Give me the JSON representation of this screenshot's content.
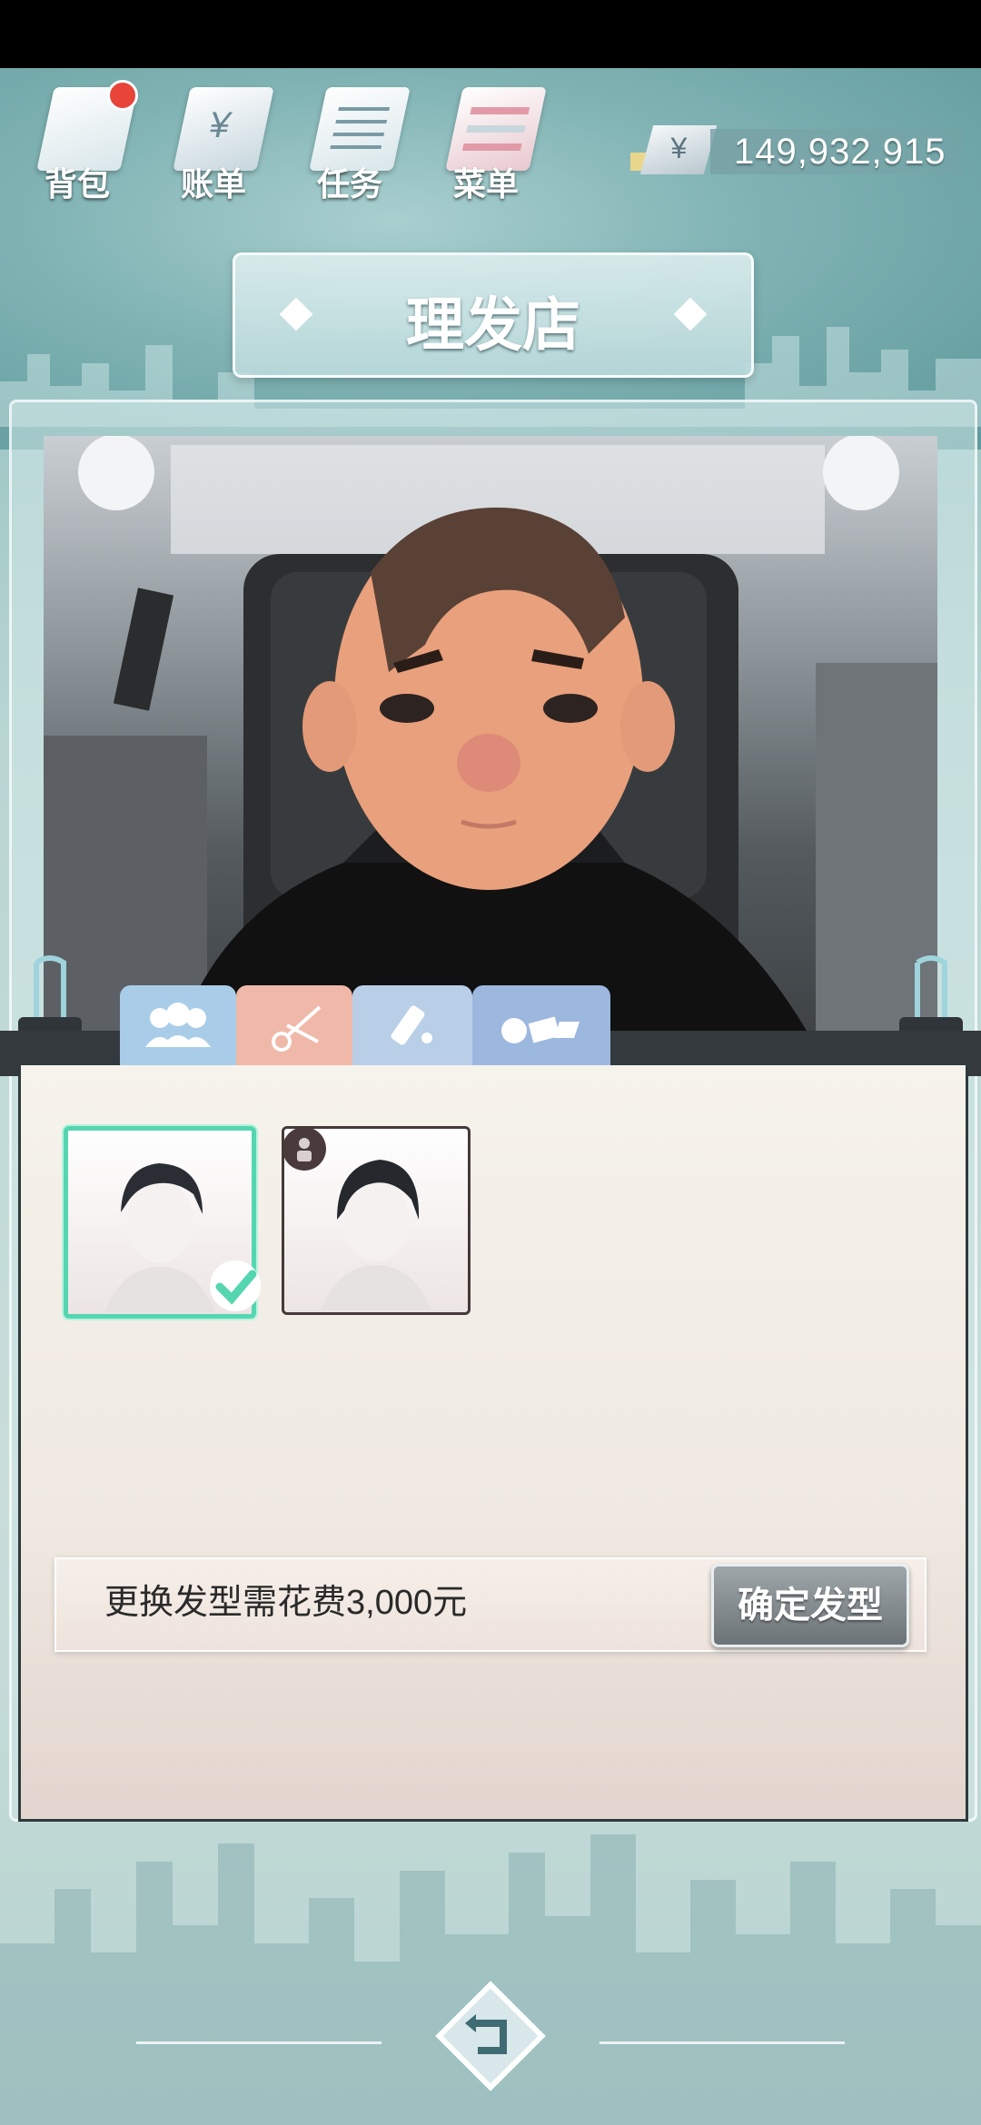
{
  "nav": {
    "items": [
      {
        "label": "背包",
        "icon": "backpack-icon",
        "has_badge": true
      },
      {
        "label": "账单",
        "icon": "bill-icon"
      },
      {
        "label": "任务",
        "icon": "task-icon"
      },
      {
        "label": "菜单",
        "icon": "menu-icon"
      }
    ]
  },
  "currency": {
    "symbol": "¥",
    "amount": "149,932,915"
  },
  "title": "理发店",
  "tabs": [
    {
      "icon": "people-icon",
      "color": "#a9cde8"
    },
    {
      "icon": "scissors-icon",
      "color": "#f0b8a8",
      "active": true
    },
    {
      "icon": "tools-icon",
      "color": "#b9cfe8"
    },
    {
      "icon": "accessories-icon",
      "color": "#9db8df"
    }
  ],
  "hairstyles": [
    {
      "selected": true,
      "locked": false
    },
    {
      "selected": false,
      "locked": true
    }
  ],
  "footer": {
    "cost_text": "更换发型需花费3,000元",
    "confirm_label": "确定发型"
  }
}
